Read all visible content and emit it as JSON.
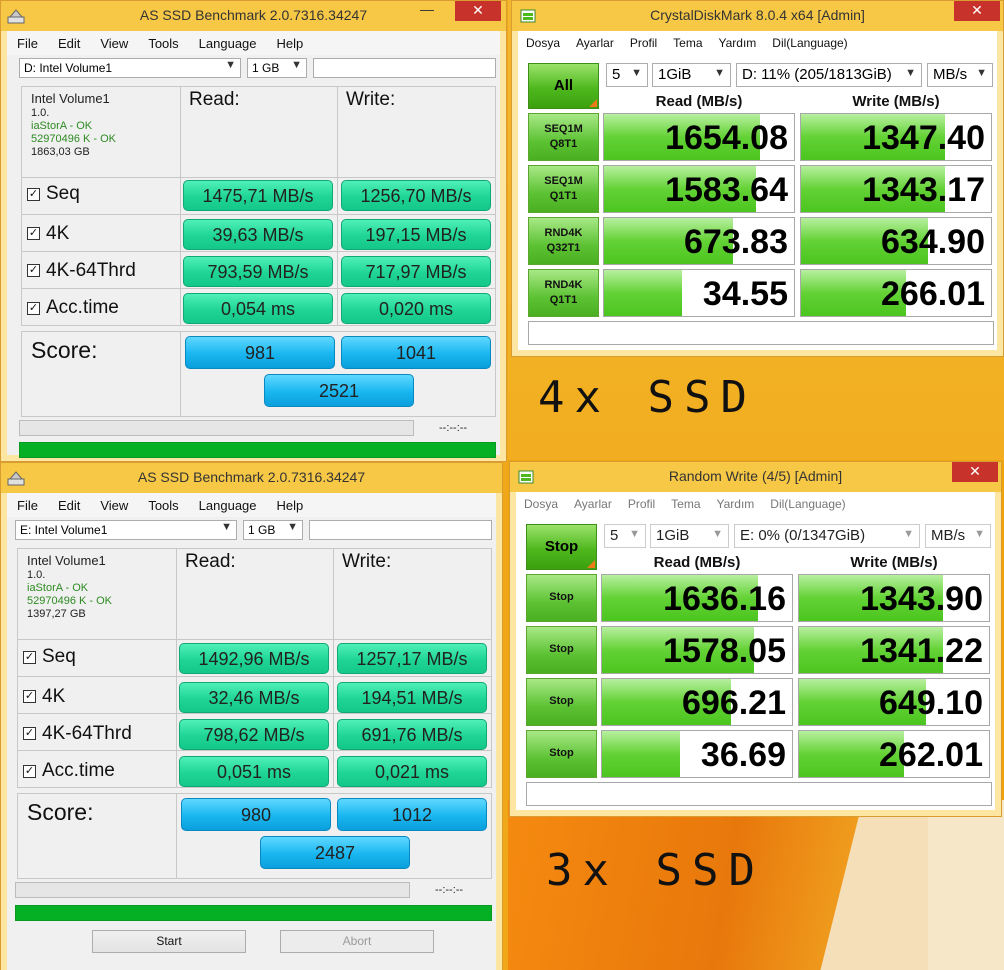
{
  "as_ssd_top": {
    "title": "AS SSD Benchmark 2.0.7316.34247",
    "menu": [
      "File",
      "Edit",
      "View",
      "Tools",
      "Language",
      "Help"
    ],
    "drive_select": "D: Intel Volume1",
    "size_select": "1 GB",
    "drive_name": "Intel Volume1",
    "drive_version": "1.0.",
    "driver_status": "iaStorA - OK",
    "alignment_status": "52970496 K - OK",
    "capacity": "1863,03 GB",
    "read_header": "Read:",
    "write_header": "Write:",
    "rows": [
      {
        "label": "Seq",
        "read": "1475,71 MB/s",
        "write": "1256,70 MB/s"
      },
      {
        "label": "4K",
        "read": "39,63 MB/s",
        "write": "197,15 MB/s"
      },
      {
        "label": "4K-64Thrd",
        "read": "793,59 MB/s",
        "write": "717,97 MB/s"
      },
      {
        "label": "Acc.time",
        "read": "0,054 ms",
        "write": "0,020 ms"
      }
    ],
    "score_label": "Score:",
    "score_read": "981",
    "score_write": "1041",
    "score_total": "2521",
    "time": "--:--:--",
    "close_glyph": "✕"
  },
  "as_ssd_bottom": {
    "title": "AS SSD Benchmark 2.0.7316.34247",
    "menu": [
      "File",
      "Edit",
      "View",
      "Tools",
      "Language",
      "Help"
    ],
    "drive_select": "E: Intel Volume1",
    "size_select": "1 GB",
    "drive_name": "Intel Volume1",
    "drive_version": "1.0.",
    "driver_status": "iaStorA - OK",
    "alignment_status": "52970496 K - OK",
    "capacity": "1397,27 GB",
    "read_header": "Read:",
    "write_header": "Write:",
    "rows": [
      {
        "label": "Seq",
        "read": "1492,96 MB/s",
        "write": "1257,17 MB/s"
      },
      {
        "label": "4K",
        "read": "32,46 MB/s",
        "write": "194,51 MB/s"
      },
      {
        "label": "4K-64Thrd",
        "read": "798,62 MB/s",
        "write": "691,76 MB/s"
      },
      {
        "label": "Acc.time",
        "read": "0,051 ms",
        "write": "0,021 ms"
      }
    ],
    "score_label": "Score:",
    "score_read": "980",
    "score_write": "1012",
    "score_total": "2487",
    "time": "--:--:--",
    "start_label": "Start",
    "abort_label": "Abort"
  },
  "cdm_top": {
    "title": "CrystalDiskMark 8.0.4 x64 [Admin]",
    "menu": [
      "Dosya",
      "Ayarlar",
      "Profil",
      "Tema",
      "Yardım",
      "Dil(Language)"
    ],
    "count": "5",
    "size": "1GiB",
    "drive": "D: 11% (205/1813GiB)",
    "unit": "MB/s",
    "main_button": "All",
    "read_header": "Read (MB/s)",
    "write_header": "Write (MB/s)",
    "rows": [
      {
        "line1": "SEQ1M",
        "line2": "Q8T1",
        "read": "1654.08",
        "write": "1347.40",
        "read_fill": 0.82,
        "write_fill": 0.76
      },
      {
        "line1": "SEQ1M",
        "line2": "Q1T1",
        "read": "1583.64",
        "write": "1343.17",
        "read_fill": 0.8,
        "write_fill": 0.76
      },
      {
        "line1": "RND4K",
        "line2": "Q32T1",
        "read": "673.83",
        "write": "634.90",
        "read_fill": 0.68,
        "write_fill": 0.67
      },
      {
        "line1": "RND4K",
        "line2": "Q1T1",
        "read": "34.55",
        "write": "266.01",
        "read_fill": 0.41,
        "write_fill": 0.55
      }
    ],
    "close_glyph": "✕"
  },
  "cdm_bottom": {
    "title": "Random Write (4/5) [Admin]",
    "menu": [
      "Dosya",
      "Ayarlar",
      "Profil",
      "Tema",
      "Yardım",
      "Dil(Language)"
    ],
    "count": "5",
    "size": "1GiB",
    "drive": "E: 0% (0/1347GiB)",
    "unit": "MB/s",
    "main_button": "Stop",
    "read_header": "Read (MB/s)",
    "write_header": "Write (MB/s)",
    "rows": [
      {
        "line1": "Stop",
        "read": "1636.16",
        "write": "1343.90",
        "read_fill": 0.82,
        "write_fill": 0.76
      },
      {
        "line1": "Stop",
        "read": "1578.05",
        "write": "1341.22",
        "read_fill": 0.8,
        "write_fill": 0.76
      },
      {
        "line1": "Stop",
        "read": "696.21",
        "write": "649.10",
        "read_fill": 0.68,
        "write_fill": 0.67
      },
      {
        "line1": "Stop",
        "read": "36.69",
        "write": "262.01",
        "read_fill": 0.41,
        "write_fill": 0.55
      }
    ],
    "close_glyph": "✕"
  },
  "annotations": {
    "top": "4x SSD",
    "bottom": "3x SSD"
  }
}
